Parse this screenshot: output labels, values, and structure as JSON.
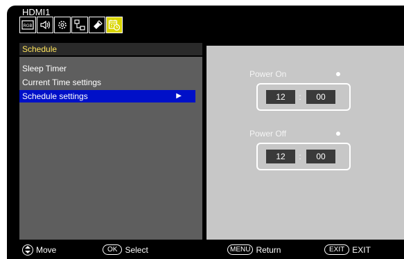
{
  "header": {
    "source": "HDMI1"
  },
  "tabs": [
    {
      "icon": "picture-rgb-icon",
      "text": "RGB"
    },
    {
      "icon": "speaker-icon"
    },
    {
      "icon": "gear-icon"
    },
    {
      "icon": "network-icon"
    },
    {
      "icon": "usb-icon"
    },
    {
      "icon": "schedule-calendar-icon",
      "active": true
    }
  ],
  "menu": {
    "title": "Schedule",
    "items": [
      {
        "label": "Sleep Timer"
      },
      {
        "label": "Current Time settings"
      },
      {
        "label": "Schedule settings",
        "selected": true,
        "arrow": "▶"
      }
    ]
  },
  "schedule": {
    "power_on": {
      "label": "Power On",
      "hour": "12",
      "minute": "00"
    },
    "power_off": {
      "label": "Power Off",
      "hour": "12",
      "minute": "00"
    },
    "separator": ":"
  },
  "footer": {
    "move": "Move",
    "ok_key": "OK",
    "select": "Select",
    "menu_key": "MENU",
    "return": "Return",
    "exit_key": "EXIT",
    "exit": "EXIT"
  }
}
